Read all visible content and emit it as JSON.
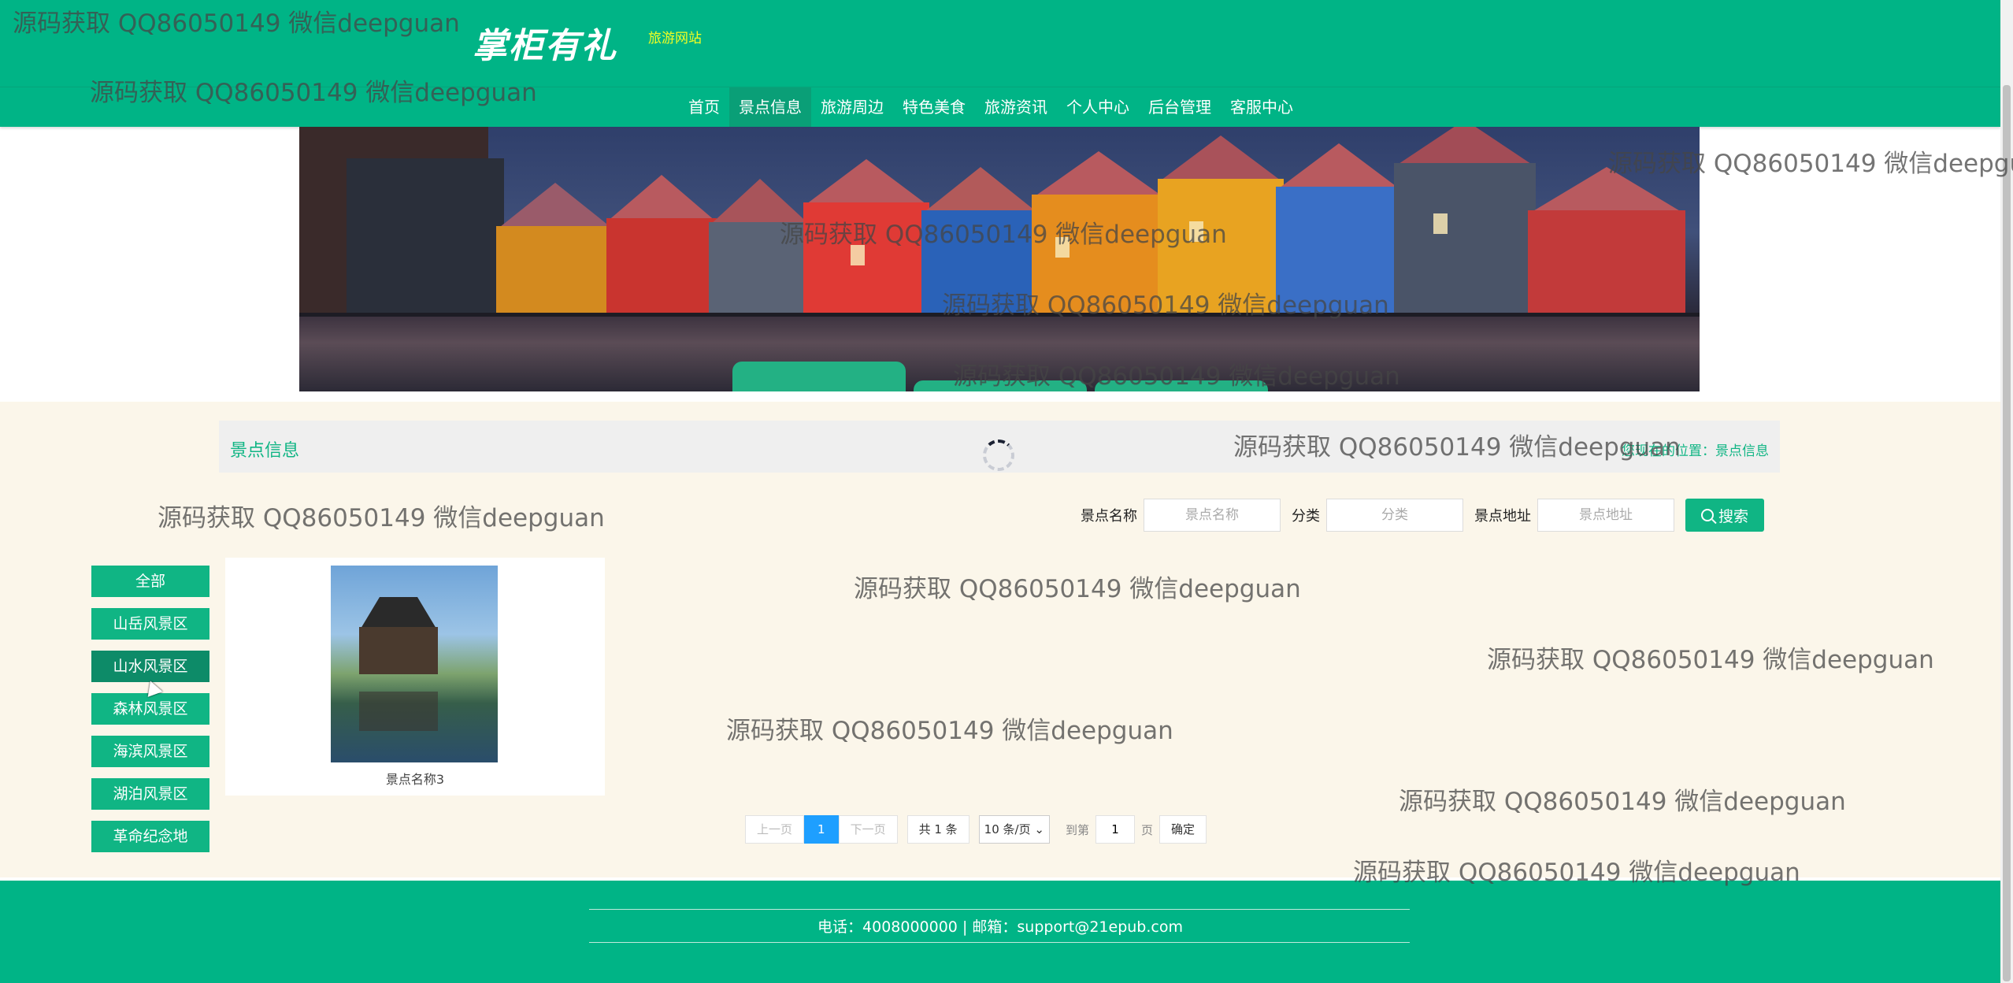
{
  "header": {
    "logo_text": "掌柜有礼",
    "logo_subtitle": "旅游网站"
  },
  "nav": {
    "items": [
      {
        "label": "首页"
      },
      {
        "label": "景点信息"
      },
      {
        "label": "旅游周边"
      },
      {
        "label": "特色美食"
      },
      {
        "label": "旅游资讯"
      },
      {
        "label": "个人中心"
      },
      {
        "label": "后台管理"
      },
      {
        "label": "客服中心"
      }
    ],
    "active_index": 1
  },
  "breadcrumb": {
    "title": "景点信息",
    "position_label": "您现在的位置：",
    "position_value": "景点信息"
  },
  "search": {
    "name_label": "景点名称",
    "name_placeholder": "景点名称",
    "category_label": "分类",
    "category_placeholder": "分类",
    "address_label": "景点地址",
    "address_placeholder": "景点地址",
    "button_label": "搜索"
  },
  "categories": [
    {
      "label": "全部"
    },
    {
      "label": "山岳风景区"
    },
    {
      "label": "山水风景区"
    },
    {
      "label": "森林风景区"
    },
    {
      "label": "海滨风景区"
    },
    {
      "label": "湖泊风景区"
    },
    {
      "label": "革命纪念地"
    }
  ],
  "active_category_index": 2,
  "items": [
    {
      "name": "景点名称3"
    }
  ],
  "pagination": {
    "prev": "上一页",
    "current": "1",
    "next": "下一页",
    "total": "共 1 条",
    "per_page": "10 条/页",
    "goto_label": "到第",
    "goto_value": "1",
    "page_unit": "页",
    "confirm": "确定"
  },
  "footer": {
    "contact": "电话：4008000000 | 邮箱：support@21epub.com"
  },
  "watermark_text": "源码获取 QQ86050149 微信deepguan",
  "colors": {
    "primary": "#00b486",
    "accent": "#10b584",
    "page_bg": "#fbf6ea",
    "pager_active": "#1e9fff"
  }
}
